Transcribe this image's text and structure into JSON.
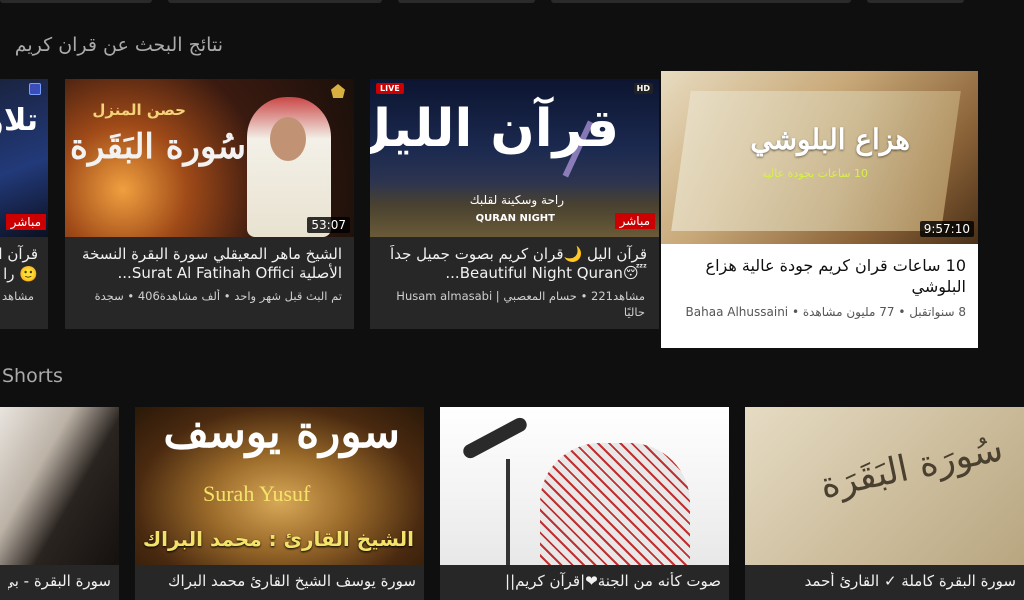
{
  "search_results": {
    "title": "نتائج البحث عن قران كريم",
    "cards": [
      {
        "title": "تلاو",
        "live": "مباشر",
        "line1": "قرآن ا",
        "line2": "🙂 را",
        "line3": "مشاهد"
      },
      {
        "thumb_top": "حصن المنزل",
        "thumb_main": "سُورة البَقَرة",
        "duration": "53:07",
        "title": "الشيخ ماهر المعيقلي سورة البقرة النسخة الأصلية Surat Al Fatihah Offici...",
        "meta": "تم البث قبل شهر واحد • ألف مشاهدة406 • سجدة"
      },
      {
        "badge_live": "LIVE",
        "badge_hd": "HD",
        "thumb_main": "قرآن الليل",
        "thumb_sub": "راحة وسكينة لقلبك",
        "thumb_sub2": "QURAN NIGHT",
        "live": "مباشر",
        "title": "قرآن اليل 🌙قران كريم بصوت جميل جداً 😴Beautiful Night Quran...",
        "meta1": "مشاهد221 • حسام المعصبي | Husam almasabi",
        "meta2": "حاليًا"
      },
      {
        "thumb_main": "هزاع البلوشي",
        "thumb_sub": "10 ساعات بجودة عالية",
        "duration": "9:57:10",
        "title": "10 ساعات قران كريم جودة عالية هزاع البلوشي",
        "meta": "8 سنواتقبل • 77 مليون مشاهدة • Bahaa Alhussaini"
      }
    ]
  },
  "shorts": {
    "title": "Shorts",
    "items": [
      {
        "title": "سورة البقرة - بي"
      },
      {
        "thumb_main": "سورة يوسف",
        "thumb_sub": "Surah Yusuf",
        "thumb_reader": "الشيخ القارئ : محمد البراك",
        "title": "سورة يوسف الشيخ القارئ محمد البراك"
      },
      {
        "title": "صوت كأنه من الجنة❤|قرآن كريم||"
      },
      {
        "thumb_main": "سُورَة البَقَرَة",
        "title": "سورة البقرة كاملة ✓ القارئ أحمد"
      }
    ]
  }
}
